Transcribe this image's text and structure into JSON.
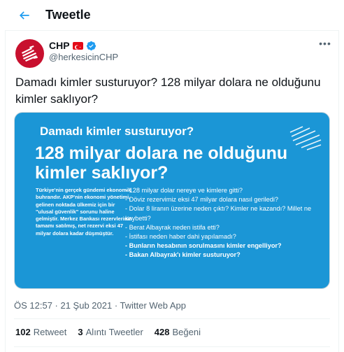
{
  "header": {
    "title": "Tweetle"
  },
  "author": {
    "name": "CHP",
    "handle": "@herkesicinCHP",
    "verified": true,
    "flag": "turkish-flag",
    "avatar_color": "#c8102e"
  },
  "tweet": {
    "text": "Damadı kimler susturuyor? 128 milyar dolara ne olduğunu kimler saklıyor?"
  },
  "media": {
    "background_color": "#1b96d6",
    "subtitle": "Damadı kimler susturuyor?",
    "title": "128 milyar dolara ne olduğunu kimler saklıyor?",
    "left_text": "Türkiye'nin gerçek gündemi ekonomik buhrandır. AKP'nin ekonomi yönetimi, gelinen noktada ülkemiz için bir \"ulusal güvenlik\" sorunu haline gelmiştir. Merkez Bankası rezervlerinin tamamı satılmış, net rezervi eksi 47 milyar dolara kadar düşmüştür.",
    "questions": [
      "- 128 milyar dolar nereye ve kimlere gitti?",
      "- Döviz rezervimiz eksi 47 milyar dolara nasıl geriledi?",
      "- Dolar 8 liranın üzerine neden çıktı? Kimler ne kazandı? Millet ne kaybetti?",
      "- Berat Albayrak neden istifa etti?",
      "- İstifası neden haber dahi yapılamadı?",
      "- Bunların  hesabının sorulmasını kimler engelliyor?",
      "- Bakan Albayrak'ı kimler susturuyor?"
    ]
  },
  "meta": {
    "timestamp": "ÖS 12:57 · 21 Şub 2021 · Twitter Web App"
  },
  "stats": {
    "retweets": "102",
    "retweets_label": "Retweet",
    "quotes": "3",
    "quotes_label": "Alıntı Tweetler",
    "likes": "428",
    "likes_label": "Beğeni"
  }
}
